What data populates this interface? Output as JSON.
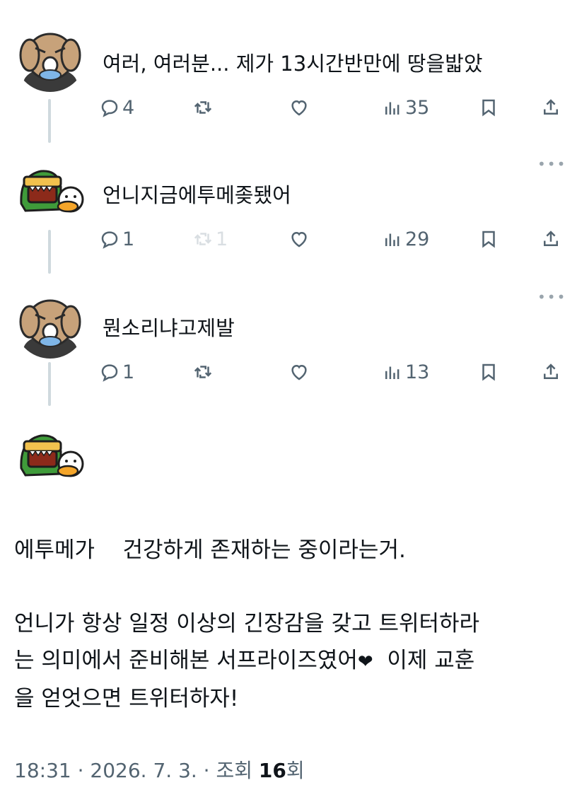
{
  "tweets": [
    {
      "user": "dog",
      "text": "여러, 여러분... 제가 13시간반만에 땅을밟았",
      "actions": {
        "reply": "4",
        "retweet": "",
        "like": "",
        "views": "35"
      }
    },
    {
      "user": "croc",
      "text": "언니지금에투메좆됐어",
      "actions": {
        "reply": "1",
        "retweet": "1",
        "like": "",
        "views": "29"
      }
    },
    {
      "user": "dog",
      "text": "뭔소리냐고제발",
      "actions": {
        "reply": "1",
        "retweet": "",
        "like": "",
        "views": "13"
      }
    }
  ],
  "main_post": {
    "lines": [
      "에투메가    건강하게 존재하는 중이라는거.",
      "",
      "언니가 항상 일정 이상의 긴장감을 갖고 트위터하라",
      "는 의미에서 준비해본 서프라이즈였어",
      "을 얻엇으면 트위터하자!"
    ],
    "line4_tail": "  이제 교훈",
    "heart": "❤"
  },
  "meta": {
    "time_date": "18:31 · 2026. 7. 3. · 조회 ",
    "views": "16",
    "views_suffix": "회"
  },
  "icons": {
    "reply": "reply-bubble-icon",
    "retweet": "retweet-icon",
    "like": "heart-icon",
    "views": "views-bar-icon",
    "bookmark": "bookmark-icon",
    "share": "share-icon",
    "more": "more-dots-icon"
  }
}
